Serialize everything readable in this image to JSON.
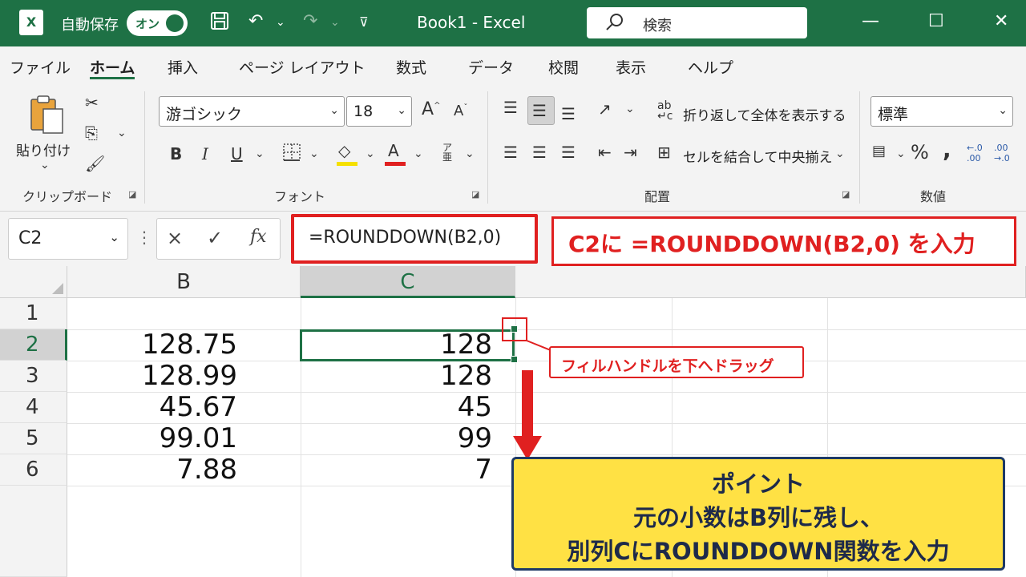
{
  "titlebar": {
    "app_letter": "X",
    "autosave_label": "自動保存",
    "autosave_state": "オン",
    "title": "Book1  -  Excel",
    "search_placeholder": "検索"
  },
  "tabs": [
    "ファイル",
    "ホーム",
    "挿入",
    "ページ レイアウト",
    "数式",
    "データ",
    "校閲",
    "表示",
    "ヘルプ"
  ],
  "active_tab": "ホーム",
  "ribbon": {
    "clipboard": {
      "paste_label": "貼り付け",
      "group_label": "クリップボード"
    },
    "font": {
      "font_name": "游ゴシック",
      "font_size": "18",
      "bold": "B",
      "italic": "I",
      "underline": "U",
      "group_label": "フォント",
      "font_color": "#e02020",
      "fill_color": "#f5e000"
    },
    "alignment": {
      "wrap_text": "折り返して全体を表示する",
      "merge_center": "セルを結合して中央揃え",
      "group_label": "配置"
    },
    "number": {
      "format": "標準",
      "percent": "%",
      "comma": ",",
      "group_label": "数値"
    }
  },
  "formula_bar": {
    "name_box": "C2",
    "cancel_icon": "×",
    "enter_icon": "✓",
    "fx": "fx",
    "formula": "=ROUNDDOWN(B2,0)"
  },
  "annotations": {
    "top_callout": "C2に =ROUNDDOWN(B2,0) を入力",
    "fill_callout": "フィルハンドルを下へドラッグ",
    "point_title": "ポイント",
    "point_line1": "元の小数はB列に残し、",
    "point_line2": "別列CにROUNDDOWN関数を入力"
  },
  "grid": {
    "columns": [
      "B",
      "C"
    ],
    "rows": [
      "1",
      "2",
      "3",
      "4",
      "5",
      "6"
    ],
    "selected_cell": "C2",
    "data": [
      {
        "row": "1",
        "B": "",
        "C": ""
      },
      {
        "row": "2",
        "B": "128.75",
        "C": "128"
      },
      {
        "row": "3",
        "B": "128.99",
        "C": "128"
      },
      {
        "row": "4",
        "B": "45.67",
        "C": "45"
      },
      {
        "row": "5",
        "B": "99.01",
        "C": "99"
      },
      {
        "row": "6",
        "B": "7.88",
        "C": "7"
      }
    ]
  },
  "colors": {
    "excel_green": "#1e7145",
    "annotation_red": "#e02020",
    "point_yellow": "#ffe144",
    "point_border": "#1e3a66"
  }
}
